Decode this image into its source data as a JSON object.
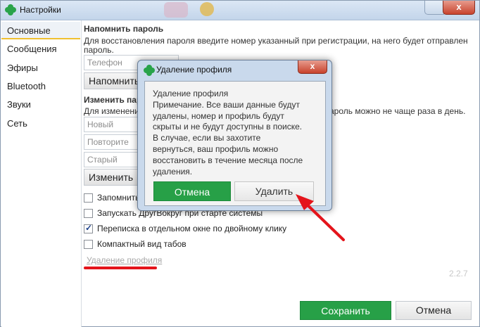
{
  "window": {
    "title": "Настройки",
    "close_glyph": "x"
  },
  "sidebar": {
    "items": [
      {
        "label": "Основные"
      },
      {
        "label": "Сообщения"
      },
      {
        "label": "Эфиры"
      },
      {
        "label": "Bluetooth"
      },
      {
        "label": "Звуки"
      },
      {
        "label": "Сеть"
      }
    ]
  },
  "remind": {
    "heading": "Напомнить пароль",
    "desc_line1": "Для восстановления пароля введите номер указанный при регистрации, на него будет отправлен",
    "desc_line2": "пароль.",
    "phone_placeholder": "Телефон",
    "button": "Напомнить"
  },
  "change": {
    "heading": "Изменить паро",
    "desc_left": "Для изменения",
    "desc_right": "ароль можно не чаще раза в день.",
    "new_pass": "Новый пароль",
    "repeat_pass": "Повторите пар",
    "old_pass": "Старый пароль",
    "button": "Изменить"
  },
  "options": [
    {
      "label": "Запомнить",
      "checked": false
    },
    {
      "label": "Запускать ДругВокруг при старте системы",
      "checked": false
    },
    {
      "label": "Переписка в отдельном окне по двойному клику",
      "checked": true
    },
    {
      "label": "Компактный вид табов",
      "checked": false
    }
  ],
  "delete_link": "Удаление профиля",
  "version": "2.2.7",
  "footer": {
    "save": "Сохранить",
    "cancel": "Отмена"
  },
  "modal": {
    "title": "Удаление профиля",
    "close_glyph": "x",
    "lines": [
      "Удаление профиля",
      "Примечание. Все ваши данные будут",
      "удалены, номер и профиль будут",
      "скрыты и не будут доступны в поиске.",
      "В случае, если вы захотите",
      "вернуться, ваш профиль можно",
      "восстановить в течение месяца после",
      "удаления."
    ],
    "cancel": "Отмена",
    "delete": "Удалить"
  },
  "colors": {
    "accent_green": "#27a047",
    "annotation_red": "#e4141b"
  }
}
